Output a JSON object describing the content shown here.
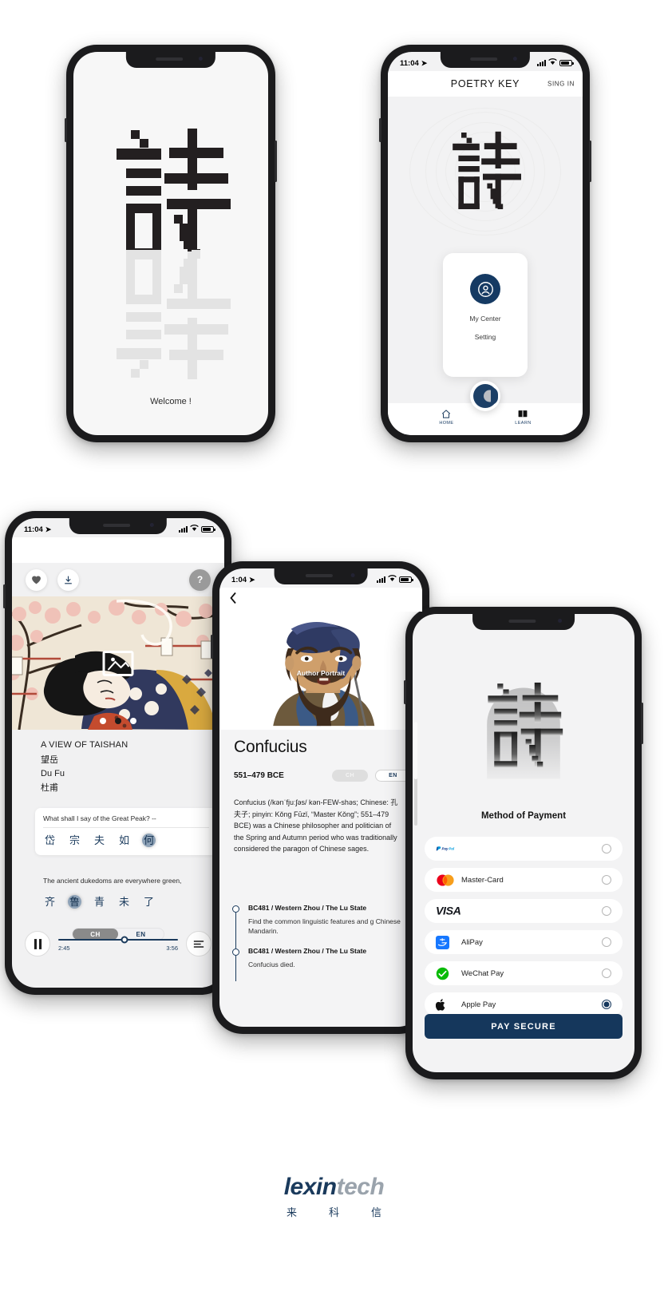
{
  "app": {
    "name": "POETRY KEY",
    "glyph": "詩"
  },
  "phone1_splash": {
    "welcome": "Welcome !",
    "glyph": "詩",
    "glyph_reflection": "詩"
  },
  "phone2_home": {
    "status": {
      "time": "11:04",
      "location_arrow": "location-arrow"
    },
    "header": {
      "title": "POETRY KEY",
      "signin": "SING IN"
    },
    "menu_card": {
      "avatar_icon": "user-circle-icon",
      "items": [
        "My Center",
        "Setting"
      ]
    },
    "fab": "logo-fab",
    "tabs": [
      {
        "label": "HOME",
        "icon": "home-icon"
      },
      {
        "label": "LEARN",
        "icon": "book-icon"
      }
    ]
  },
  "phone3_poem": {
    "status": {
      "time": "11:04"
    },
    "actions": {
      "favorite": "heart-icon",
      "download": "download-icon",
      "help": "?"
    },
    "artwork": {
      "caption": "ukiyo-e-illustration",
      "dots": 3,
      "active_dot": 2
    },
    "title_en": "A VIEW OF TAISHAN",
    "title_cn": "望岳",
    "author_en": "Du Fu",
    "author_cn": "杜甫",
    "lines": [
      {
        "en": "What shall I say of the Great Peak? --",
        "cn": [
          "岱",
          "宗",
          "夫",
          "如",
          "何"
        ],
        "highlight_index": 4
      },
      {
        "en": "The ancient dukedoms are everywhere green,",
        "cn": [
          "齐",
          "鲁",
          "青",
          "未",
          "了"
        ],
        "highlight_index": 1
      }
    ],
    "language_toggle": {
      "options": [
        "CH",
        "EN"
      ],
      "selected": "CH"
    },
    "player": {
      "play_state": "pause",
      "current_time": "2:45",
      "total_time": "3:56",
      "progress_percent": 55,
      "list_icon": "playlist-icon"
    }
  },
  "phone4_author": {
    "status": {
      "time": "1:04"
    },
    "back_icon": "chevron-left-icon",
    "portrait_label": "Author Portrait",
    "name": "Confucius",
    "years": "551–479 BCE",
    "language_toggle": {
      "options": [
        "CH",
        "EN"
      ],
      "selected": "EN"
    },
    "bio": "Confucius (/kənˈfjuːʃəs/ kən-FEW-shəs; Chinese: 孔夫子; pinyin: Kǒng Fūzǐ, “Master Kǒng”; 551–479 BCE) was a Chinese philosopher and politician of the Spring and Autumn period who was traditionally considered the paragon of Chinese sages.",
    "timeline": [
      {
        "title": "BC481 /  Western Zhou / The Lu State",
        "body": "Find the common linguistic features and g Chinese Mandarin."
      },
      {
        "title": "BC481 /  Western Zhou / The Lu State",
        "body": "Confucius died."
      }
    ]
  },
  "phone5_payment": {
    "logo_glyph": "詩",
    "title": "Method of Payment",
    "methods": [
      {
        "label": "PayPal",
        "icon": "paypal-logo",
        "selected": false
      },
      {
        "label": "Master-Card",
        "icon": "mastercard-logo",
        "selected": false
      },
      {
        "label": "VISA",
        "icon": "visa-logo",
        "selected": false
      },
      {
        "label": "AliPay",
        "icon": "alipay-logo",
        "selected": false
      },
      {
        "label": "WeChat Pay",
        "icon": "wechat-logo",
        "selected": false
      },
      {
        "label": "Apple Pay",
        "icon": "apple-logo",
        "selected": true
      }
    ],
    "pay_button": "PAY SECURE"
  },
  "footer": {
    "logo_bold": "lexin",
    "logo_light": "tech",
    "sub": [
      "来",
      "科",
      "信"
    ]
  },
  "colors": {
    "navy": "#15375c",
    "accent": "#1a3a5c",
    "background": "#ffffff",
    "screen_bg": "#f3f3f4"
  }
}
